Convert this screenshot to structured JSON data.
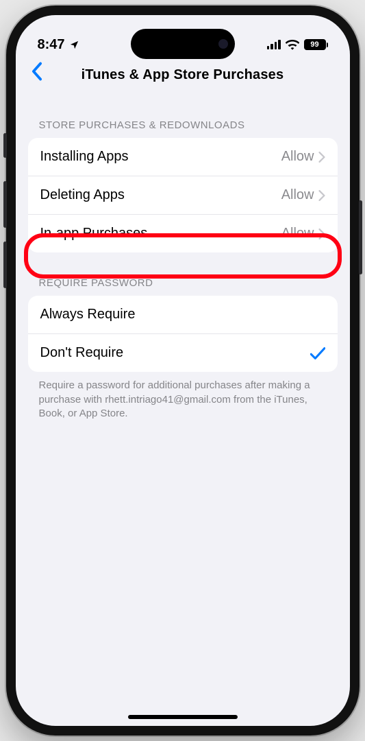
{
  "status": {
    "time": "8:47",
    "battery_pct": "99"
  },
  "nav": {
    "title": "iTunes & App Store Purchases"
  },
  "section1": {
    "header": "STORE PURCHASES & REDOWNLOADS",
    "rows": [
      {
        "label": "Installing Apps",
        "value": "Allow"
      },
      {
        "label": "Deleting Apps",
        "value": "Allow"
      },
      {
        "label": "In-app Purchases",
        "value": "Allow"
      }
    ]
  },
  "section2": {
    "header": "REQUIRE PASSWORD",
    "rows": [
      {
        "label": "Always Require",
        "selected": false
      },
      {
        "label": "Don't Require",
        "selected": true
      }
    ],
    "footer": "Require a password for additional purchases after making a purchase with rhett.intriago41@gmail.com from the iTunes, Book, or App Store."
  }
}
